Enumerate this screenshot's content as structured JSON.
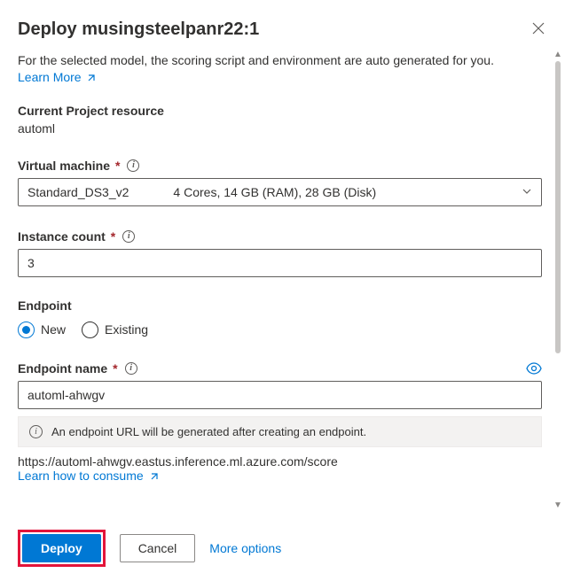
{
  "header": {
    "title": "Deploy musingsteelpanr22:1"
  },
  "intro": {
    "description": "For the selected model, the scoring script and environment are auto generated for you.",
    "learn_more": "Learn More"
  },
  "project": {
    "label": "Current Project resource",
    "value": "automl"
  },
  "vm": {
    "label": "Virtual machine",
    "selected_name": "Standard_DS3_v2",
    "selected_spec": "4 Cores, 14 GB (RAM), 28 GB (Disk)"
  },
  "instance": {
    "label": "Instance count",
    "value": "3"
  },
  "endpoint_section": {
    "label": "Endpoint",
    "options": {
      "new": "New",
      "existing": "Existing"
    },
    "selected": "new"
  },
  "endpoint_name": {
    "label": "Endpoint name",
    "value": "automl-ahwgv"
  },
  "banner": {
    "text": "An endpoint URL will be generated after creating an endpoint."
  },
  "endpoint_url": "https://automl-ahwgv.eastus.inference.ml.azure.com/score",
  "consume_link": "Learn how to consume",
  "footer": {
    "deploy": "Deploy",
    "cancel": "Cancel",
    "more": "More options"
  }
}
